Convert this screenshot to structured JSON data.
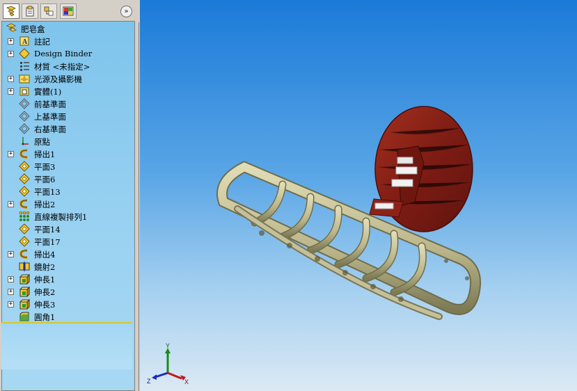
{
  "panel": {
    "tabs": [
      {
        "name": "feature-manager-tab",
        "icon": "feature-tree-icon",
        "active": true
      },
      {
        "name": "property-manager-tab",
        "icon": "property-icon",
        "active": false
      },
      {
        "name": "configuration-manager-tab",
        "icon": "configuration-icon",
        "active": false
      },
      {
        "name": "display-manager-tab",
        "icon": "display-icon",
        "active": false
      }
    ],
    "collapse_label": "»"
  },
  "tree": {
    "root": {
      "label": "肥皂盒",
      "icon": "part-icon"
    },
    "items": [
      {
        "label": "註記",
        "icon": "annotations-icon",
        "expandable": true
      },
      {
        "label": "Design Binder",
        "icon": "design-binder-icon",
        "expandable": true
      },
      {
        "label": "材質 <未指定>",
        "icon": "material-icon",
        "expandable": false
      },
      {
        "label": "光源及攝影機",
        "icon": "lights-cameras-icon",
        "expandable": true
      },
      {
        "label": "實體(1)",
        "icon": "solid-bodies-icon",
        "expandable": true
      },
      {
        "label": "前基準面",
        "icon": "plane-icon",
        "expandable": false
      },
      {
        "label": "上基準面",
        "icon": "plane-icon",
        "expandable": false
      },
      {
        "label": "右基準面",
        "icon": "plane-icon",
        "expandable": false
      },
      {
        "label": "原點",
        "icon": "origin-icon",
        "expandable": false
      },
      {
        "label": "掃出1",
        "icon": "sweep-icon",
        "expandable": true
      },
      {
        "label": "平面3",
        "icon": "ref-plane-icon",
        "expandable": false
      },
      {
        "label": "平面6",
        "icon": "ref-plane-icon",
        "expandable": false
      },
      {
        "label": "平面13",
        "icon": "ref-plane-icon",
        "expandable": false
      },
      {
        "label": "掃出2",
        "icon": "sweep-icon",
        "expandable": true
      },
      {
        "label": "直線複製排列1",
        "icon": "linear-pattern-icon",
        "expandable": false
      },
      {
        "label": "平面14",
        "icon": "ref-plane-icon",
        "expandable": false
      },
      {
        "label": "平面17",
        "icon": "ref-plane-icon",
        "expandable": false
      },
      {
        "label": "掃出4",
        "icon": "sweep-icon",
        "expandable": true
      },
      {
        "label": "鏡射2",
        "icon": "mirror-icon",
        "expandable": false
      },
      {
        "label": "伸長1",
        "icon": "extrude-icon",
        "expandable": true
      },
      {
        "label": "伸長2",
        "icon": "extrude-icon",
        "expandable": true
      },
      {
        "label": "伸長3",
        "icon": "extrude-icon",
        "expandable": true
      },
      {
        "label": "圓角1",
        "icon": "fillet-icon",
        "expandable": false
      }
    ]
  },
  "triad": {
    "x": "X",
    "y": "Y",
    "z": "Z"
  },
  "colors": {
    "viewport_top": "#1b7ad8",
    "viewport_bottom": "#dbe9f4",
    "tree_bg": "#8ccbef",
    "basket": "#c8c39c",
    "plate": "#8b2218"
  }
}
